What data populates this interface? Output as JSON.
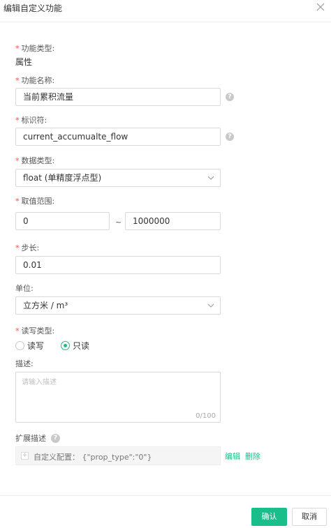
{
  "dialog": {
    "title": "编辑自定义功能"
  },
  "form": {
    "function_type": {
      "label": "功能类型:",
      "value": "属性"
    },
    "function_name": {
      "label": "功能名称:",
      "value": "当前累积流量"
    },
    "identifier": {
      "label": "标识符:",
      "value": "current_accumualte_flow"
    },
    "data_type": {
      "label": "数据类型:",
      "value": "float (单精度浮点型)"
    },
    "value_range": {
      "label": "取值范围:",
      "min": "0",
      "separator": "~",
      "max": "1000000"
    },
    "step": {
      "label": "步长:",
      "value": "0.01"
    },
    "unit": {
      "label": "单位:",
      "value": "立方米 / m³"
    },
    "rw_type": {
      "label": "读写类型:",
      "options": [
        "读写",
        "只读"
      ],
      "selected": "只读"
    },
    "description": {
      "label": "描述:",
      "placeholder": "请输入描述",
      "counter": "0/100"
    },
    "extension": {
      "label": "扩展描述",
      "config_text": "自定义配置：  {\"prop_type\":\"0\"}",
      "edit_label": "编辑",
      "delete_label": "删除"
    },
    "required_mark": "*"
  },
  "footer": {
    "confirm_label": "确认",
    "cancel_label": "取消"
  },
  "colors": {
    "accent": "#19be8b",
    "required": "#ff4d4f"
  }
}
